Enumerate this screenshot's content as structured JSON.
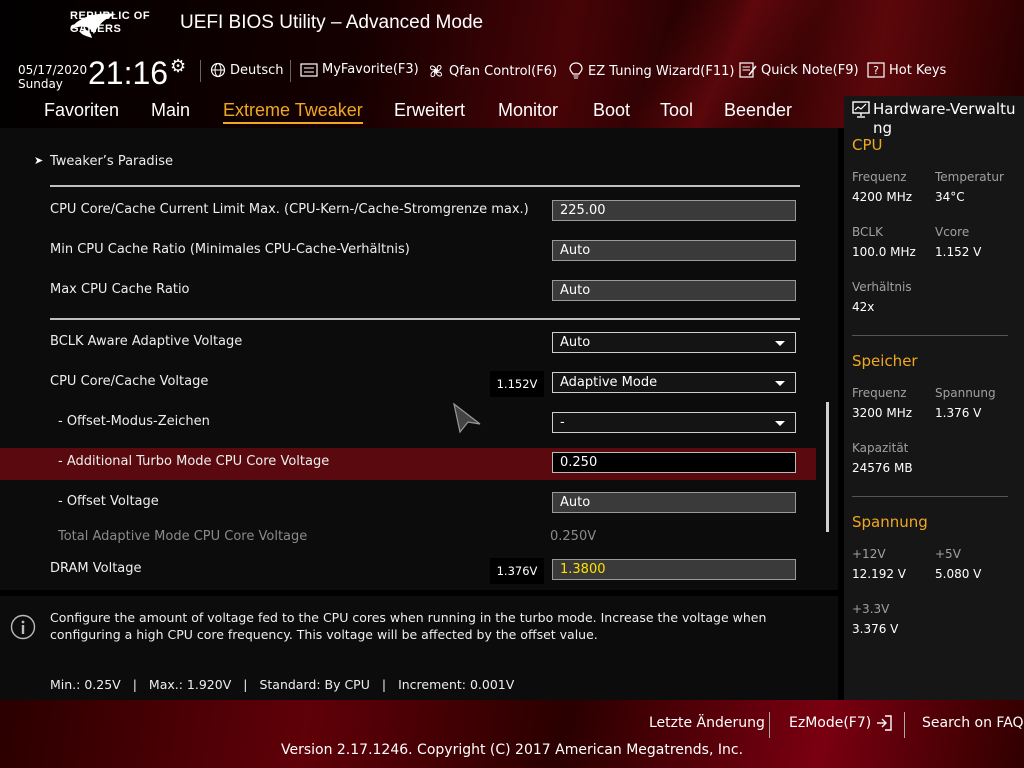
{
  "header": {
    "logo_text": "REPUBLIC OF\nGAMERS",
    "title": "UEFI BIOS Utility – Advanced Mode",
    "date": "05/17/2020",
    "weekday": "Sunday",
    "time": "21:16",
    "toolbar": {
      "language": "Deutsch",
      "myfavorite": "MyFavorite(F3)",
      "qfan": "Qfan Control(F6)",
      "ez_tuning": "EZ Tuning Wizard(F11)",
      "quick_note": "Quick Note(F9)",
      "hot_keys": "Hot Keys"
    }
  },
  "tabs": [
    "Favoriten",
    "Main",
    "Extreme Tweaker",
    "Erweitert",
    "Monitor",
    "Boot",
    "Tool",
    "Beender"
  ],
  "active_tab": "Extreme Tweaker",
  "main": {
    "section": "Tweaker’s Paradise",
    "rows": {
      "cpu_current_limit": {
        "label": "CPU Core/Cache Current Limit Max. (CPU-Kern-/Cache-Stromgrenze max.)",
        "value": "225.00"
      },
      "min_cache_ratio": {
        "label": "Min CPU Cache Ratio (Minimales CPU-Cache-Verhältnis)",
        "value": "Auto"
      },
      "max_cache_ratio": {
        "label": "Max CPU Cache Ratio",
        "value": "Auto"
      },
      "bclk_aware": {
        "label": "BCLK Aware Adaptive Voltage",
        "value": "Auto"
      },
      "cpu_core_voltage": {
        "label": "CPU Core/Cache Voltage",
        "badge": "1.152V",
        "value": "Adaptive Mode"
      },
      "offset_sign": {
        "label": "- Offset-Modus-Zeichen",
        "value": "-"
      },
      "additional_turbo": {
        "label": "- Additional Turbo Mode CPU Core Voltage",
        "value": "0.250"
      },
      "offset_voltage": {
        "label": "- Offset Voltage",
        "value": "Auto"
      },
      "total_adaptive": {
        "label": "Total Adaptive Mode CPU Core Voltage",
        "value": "0.250V"
      },
      "dram_voltage": {
        "label": "DRAM Voltage",
        "badge": "1.376V",
        "value": "1.3800"
      }
    }
  },
  "help": {
    "description": "Configure the amount of voltage fed to the CPU cores when running in the turbo mode. Increase the voltage when configuring a high CPU core frequency. This voltage will be affected by the offset value.",
    "min": "Min.: 0.25V",
    "max": "Max.: 1.920V",
    "standard": "Standard: By CPU",
    "increment": "Increment: 0.001V"
  },
  "hardware_monitor": {
    "title": "Hardware-Verwaltung",
    "cpu": {
      "heading": "CPU",
      "freq_label": "Frequenz",
      "freq": "4200 MHz",
      "temp_label": "Temperatur",
      "temp": "34°C",
      "bclk_label": "BCLK",
      "bclk": "100.0 MHz",
      "vcore_label": "Vcore",
      "vcore": "1.152 V",
      "ratio_label": "Verhältnis",
      "ratio": "42x"
    },
    "memory": {
      "heading": "Speicher",
      "freq_label": "Frequenz",
      "freq": "3200 MHz",
      "volt_label": "Spannung",
      "volt": "1.376 V",
      "cap_label": "Kapazität",
      "cap": "24576 MB"
    },
    "voltage": {
      "heading": "Spannung",
      "v12_label": "+12V",
      "v12": "12.192 V",
      "v5_label": "+5V",
      "v5": "5.080 V",
      "v33_label": "+3.3V",
      "v33": "3.376 V"
    }
  },
  "footer": {
    "last_change": "Letzte Änderung",
    "ezmode": "EzMode(F7)",
    "faq": "Search on FAQ",
    "version": "Version 2.17.1246. Copyright (C) 2017 American Megatrends, Inc."
  },
  "colors": {
    "accent": "#f0a820",
    "highlight_row": "#5a0a0e",
    "dram_value": "#ffe000"
  }
}
